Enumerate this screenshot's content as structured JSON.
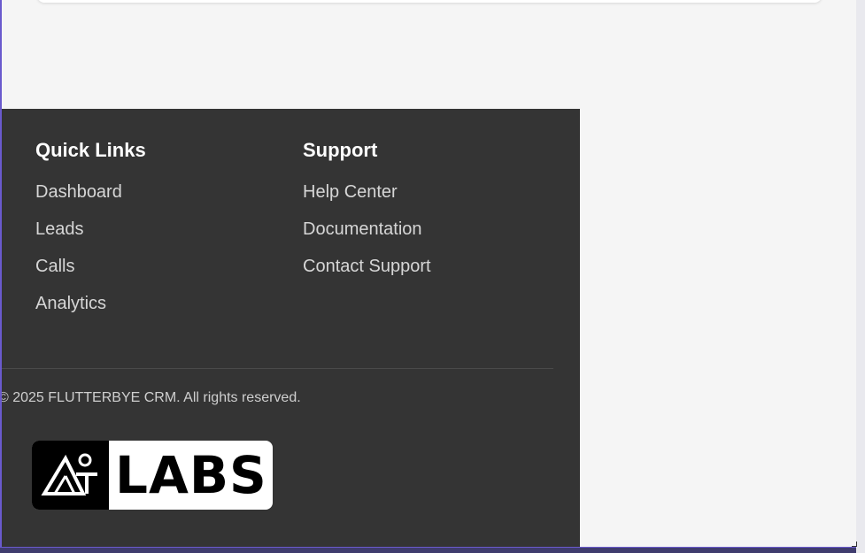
{
  "footer": {
    "quick_links": {
      "title": "Quick Links",
      "items": [
        "Dashboard",
        "Leads",
        "Calls",
        "Analytics"
      ]
    },
    "support": {
      "title": "Support",
      "items": [
        "Help Center",
        "Documentation",
        "Contact Support"
      ]
    },
    "copyright": "© 2025 FLUTTERBYE CRM. All rights reserved.",
    "logo": {
      "text": "LABS",
      "icon": "triangle-logo-icon"
    }
  },
  "colors": {
    "footer_bg": "#343434",
    "page_bg": "#f5f5f5",
    "window_border": "#6a5acd"
  }
}
